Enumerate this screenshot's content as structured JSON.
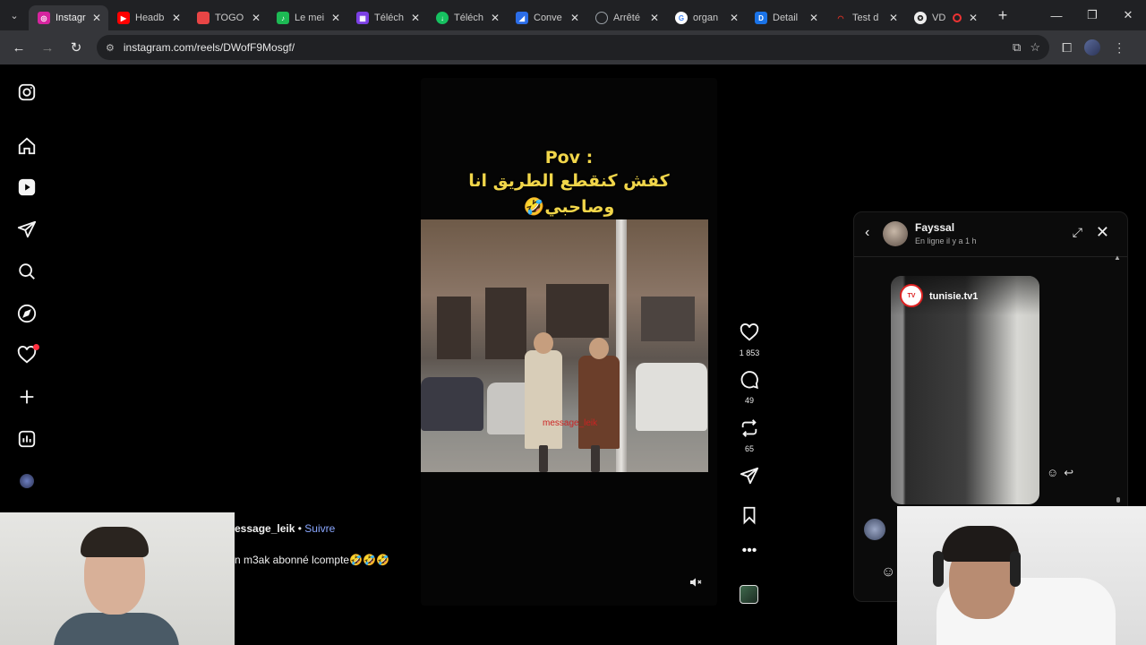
{
  "browser": {
    "tabs": [
      {
        "title": "Instagr",
        "favicon_color": "#d6249f",
        "active": true
      },
      {
        "title": "Headb",
        "favicon_color": "#ff0000",
        "active": false
      },
      {
        "title": "TOGO",
        "favicon_color": "#e84545",
        "active": false
      },
      {
        "title": "Le mei",
        "favicon_color": "#1db954",
        "active": false
      },
      {
        "title": "Téléch",
        "favicon_color": "#7b3fe4",
        "active": false
      },
      {
        "title": "Téléch",
        "favicon_color": "#16c060",
        "active": false
      },
      {
        "title": "Conve",
        "favicon_color": "#2b6de8",
        "active": false
      },
      {
        "title": "Arrêté",
        "favicon_color": "#9aa0a6",
        "active": false
      },
      {
        "title": "organ",
        "favicon_color": "#4285f4",
        "active": false
      },
      {
        "title": "Detail",
        "favicon_color": "#1a73e8",
        "active": false
      },
      {
        "title": "Test d",
        "favicon_color": "#d93025",
        "active": false
      },
      {
        "title": "VD",
        "favicon_color": "#eeeeee",
        "active": false
      }
    ],
    "url": "instagram.com/reels/DWofF9Mosgf/"
  },
  "reel": {
    "caption_line1": "Pov :",
    "caption_line2": "كفش كنقطع الطريق انا",
    "caption_line3": "وصاحبي🤣",
    "watermark": "message_leik",
    "likes": "1 853",
    "comments": "49",
    "reposts": "65",
    "username": "essage_leik",
    "separator": "•",
    "follow_label": "Suivre",
    "description": "n m3ak abonné lcompte🤣🤣🤣"
  },
  "chat": {
    "name": "Fayssal",
    "status": "En ligne il y a 1 h",
    "shared_handle": "tunisie.tv1",
    "shared_logo_text": "TV"
  },
  "icons": {
    "sidebar": [
      "instagram-icon",
      "home-icon",
      "reels-icon",
      "messages-icon",
      "search-icon",
      "explore-icon",
      "notifications-icon",
      "create-icon",
      "dashboard-icon",
      "profile-avatar"
    ]
  }
}
